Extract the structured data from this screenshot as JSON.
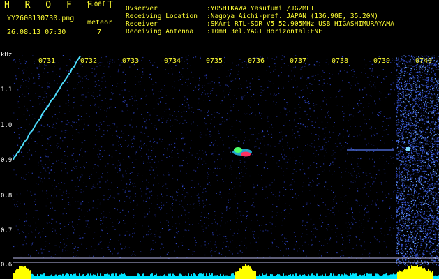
{
  "header": {
    "app_title": "H R O F F T",
    "version": "1.00f",
    "filename": "YY2608130730.png",
    "datetime": "26.08.13 07:30",
    "event_label": "meteor",
    "event_count": "7"
  },
  "info": [
    {
      "key": "Ovserver",
      "value": ":YOSHIKAWA Yasufumi /JG2MLI"
    },
    {
      "key": "Receiving Location",
      "value": ":Nagoya Aichi-pref. JAPAN (136.90E, 35.20N)"
    },
    {
      "key": "Receiver",
      "value": ":SMArt RTL-SDR V5 52.905MHz USB HIGASHIMURAYAMA"
    },
    {
      "key": "Receiving Antenna",
      "value": ":10mH 3el.YAGI Horizontal:ENE"
    }
  ],
  "axis": {
    "unit": "kHz",
    "y_ticks": [
      "1.1",
      "1.0",
      "0.9",
      "0.8",
      "0.7",
      "0.6"
    ],
    "time_ticks": [
      "0731",
      "0732",
      "0733",
      "0734",
      "0735",
      "0736",
      "0737",
      "0738",
      "0739",
      "0740"
    ]
  },
  "colors": {
    "background": "#000000",
    "noise": "#1e2a8a",
    "label": "#ffff33",
    "trace": "#4fe0ff",
    "echo_core": "#ff3060",
    "level_bar": "#ffff00"
  }
}
